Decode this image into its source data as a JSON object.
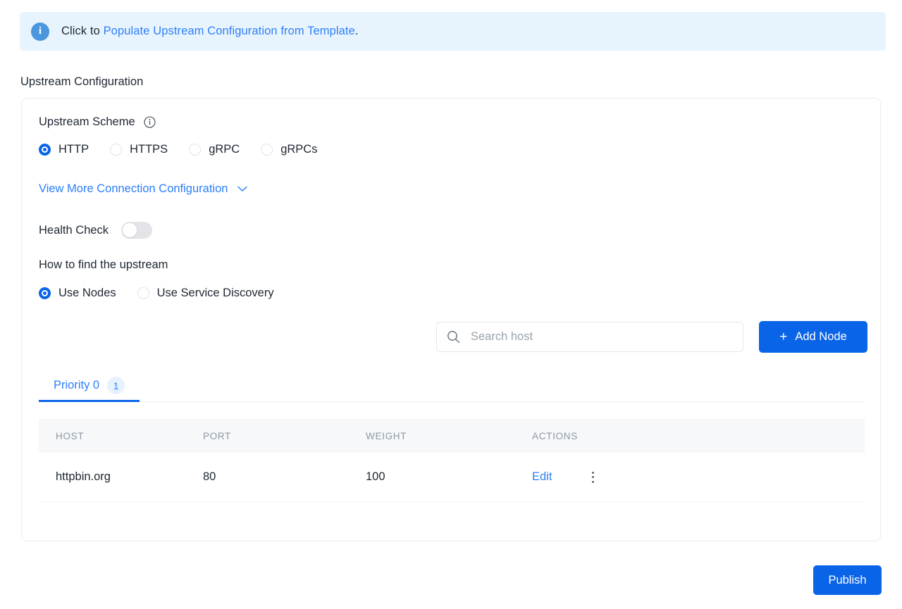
{
  "alert": {
    "icon": "info-circle-icon",
    "prefix": "Click to ",
    "link_text": "Populate Upstream Configuration from Template",
    "suffix": "."
  },
  "section": {
    "title": "Upstream Configuration"
  },
  "upstream_scheme": {
    "label": "Upstream Scheme",
    "info_icon": "info-outline-icon",
    "options": [
      {
        "label": "HTTP",
        "selected": true
      },
      {
        "label": "HTTPS",
        "selected": false
      },
      {
        "label": "gRPC",
        "selected": false
      },
      {
        "label": "gRPCs",
        "selected": false
      }
    ]
  },
  "view_more": {
    "label": "View More Connection Configuration",
    "chevron": "chevron-down-icon"
  },
  "health_check": {
    "label": "Health Check",
    "enabled": false
  },
  "find_upstream": {
    "label": "How to find the upstream",
    "options": [
      {
        "label": "Use Nodes",
        "selected": true
      },
      {
        "label": "Use Service Discovery",
        "selected": false
      }
    ]
  },
  "search": {
    "icon": "search-icon",
    "placeholder": "Search host",
    "value": ""
  },
  "add_node": {
    "plus": "+",
    "label": "Add Node"
  },
  "tabs": [
    {
      "label": "Priority 0",
      "badge": "1",
      "active": true
    }
  ],
  "table": {
    "columns": [
      "HOST",
      "PORT",
      "WEIGHT",
      "ACTIONS"
    ],
    "rows": [
      {
        "host": "httpbin.org",
        "port": "80",
        "weight": "100",
        "edit_label": "Edit",
        "more_icon": "vertical-dots-icon"
      }
    ]
  },
  "footer": {
    "publish_label": "Publish"
  },
  "colors": {
    "accent": "#0a64e8",
    "link": "#2d7ff9",
    "alert_bg": "#e8f4fd",
    "alert_icon_bg": "#4a97de",
    "table_header_bg": "#f6f8fa",
    "toggle_off_bg": "#e2e4e7",
    "badge_bg": "#e8f1fe"
  }
}
